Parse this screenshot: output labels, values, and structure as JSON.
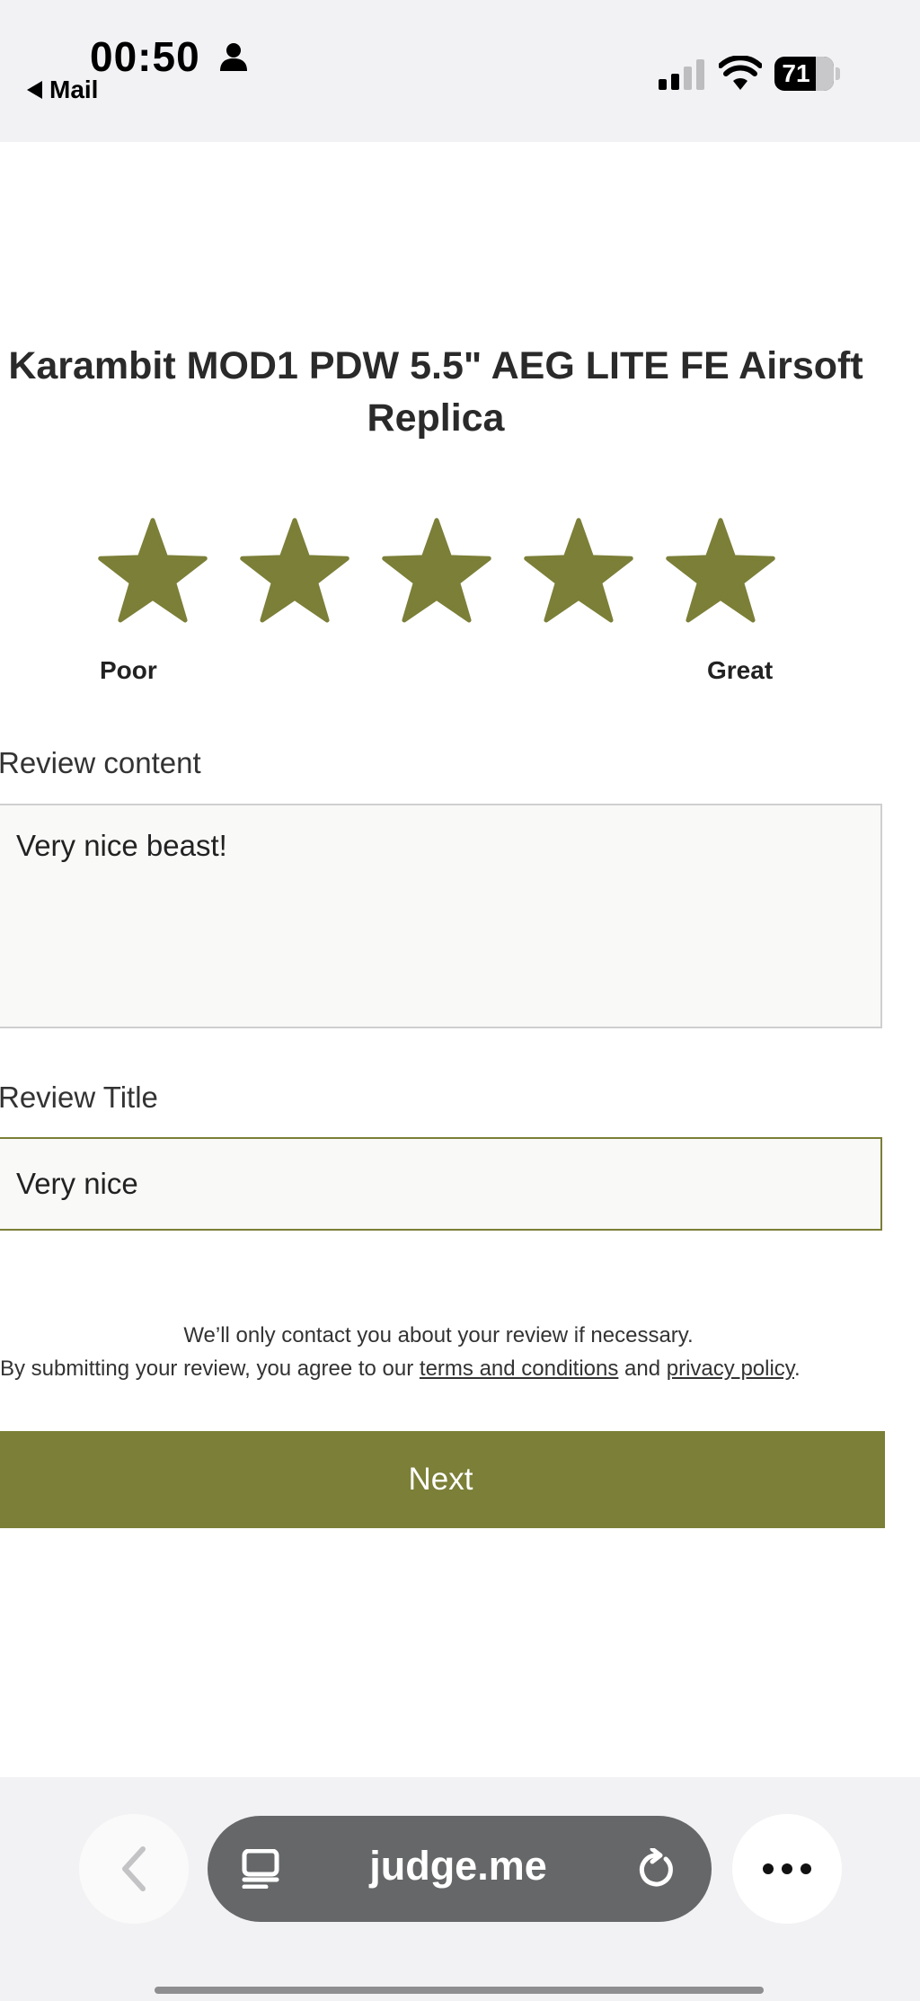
{
  "status_bar": {
    "time": "00:50",
    "back_app": "Mail",
    "battery": "71"
  },
  "product": {
    "title": "Karambit MOD1 PDW 5.5\" AEG LITE FE Airsoft Replica"
  },
  "rating": {
    "value": 5,
    "max": 5,
    "star_color": "#7b7f37",
    "label_low": "Poor",
    "label_high": "Great"
  },
  "review_content": {
    "label": "Review content",
    "value": "Very nice beast!"
  },
  "review_title": {
    "label": "Review Title",
    "value": "Very nice"
  },
  "notice": {
    "line1": "We’ll only contact you about your review if necessary.",
    "line2_prefix": "By submitting your review, you agree to our ",
    "terms_link": "terms and conditions",
    "line2_middle": " and ",
    "privacy_link": "privacy policy",
    "line2_suffix": "."
  },
  "next_button": {
    "label": "Next",
    "color": "#7b7f37"
  },
  "browser": {
    "url": "judge.me",
    "icons": [
      "back-chevron-icon",
      "tab-icon",
      "reload-icon",
      "more-icon"
    ]
  }
}
